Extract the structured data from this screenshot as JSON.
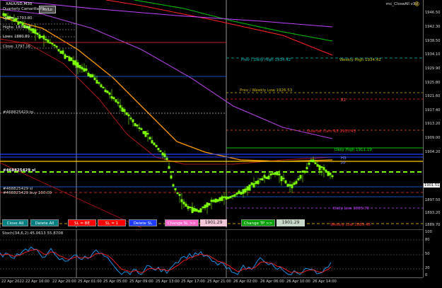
{
  "chart": {
    "symbol_label": "XAUUSD,M30",
    "info_button": "Hi/Lo",
    "expert_label": "mc_CloseAll v3d",
    "expert_icon": "smiley-icon",
    "info_lines": [
      "Quarterly Camarilla P1",
      "Opens: 1793.80",
      "Highs: 1834.14",
      "Lows: 1880.80",
      "Close: 1797.16"
    ]
  },
  "price_scale": [
    "1946.50",
    "1942.30",
    "1938.50",
    "1934.10",
    "1929.90",
    "1925.80",
    "1921.60",
    "1917.40",
    "1913.20",
    "1909.00",
    "1904.20",
    "1901.51",
    "1897.50",
    "1893.20",
    "1889.70"
  ],
  "current_price": "1901.51",
  "levels": {
    "prev_daily_high": "Prev / Daily High 1934.42",
    "weekly_high": "Weekly High 1934.42",
    "prev_weekly_low": "Prev / Weekly Low 1926.53",
    "r1": "R1",
    "quarter_cam": "Quarter Cam R3  1915.43",
    "daily_high": "Daily High 1911.19",
    "h3": "H3",
    "pp": "PP",
    "daily_low": "Daily Low 1895.70",
    "weekly_low": "Weekly Low 1889.48"
  },
  "orders": {
    "tp": "#468825429 tp",
    "sl": "#468825429 sl",
    "buy": "#468825429 buy 100.00",
    "pos": "#468825429 sl"
  },
  "buttons": {
    "close_all": "Close All",
    "delete_all": "Delete All",
    "sl_be": "SL = BE",
    "sl_1": "SL = 1",
    "delete_sl": "Delete SL",
    "change_sl": "Change SL >>",
    "change_sl_value": "1901.29",
    "change_tp": "Change TP >>",
    "change_tp_value": "1901.29"
  },
  "oscillator": {
    "label": "Stoch(34,6,2) 45.0613 55.8708",
    "scale": [
      "100",
      "80",
      "50",
      "20",
      "0"
    ]
  },
  "time_axis": [
    "22 Apr 2022",
    "22 Apr 16:00",
    "22 Apr 20:00",
    "25 Apr 01:00",
    "25 Apr 05:00",
    "25 Apr 09:00",
    "25 Apr 13:00",
    "25 Apr 17:00",
    "25 Apr 21:00",
    "26 Apr 02:00",
    "26 Apr 06:00",
    "26 Apr 10:00",
    "26 Apr 14:00"
  ],
  "colors": {
    "background": "#000000",
    "candle": "#7CFC00",
    "accent_green": "#00C000",
    "sell_red": "#FF0000",
    "blue_button": "#1E3CFF",
    "magenta_button": "#FF66CC"
  }
}
